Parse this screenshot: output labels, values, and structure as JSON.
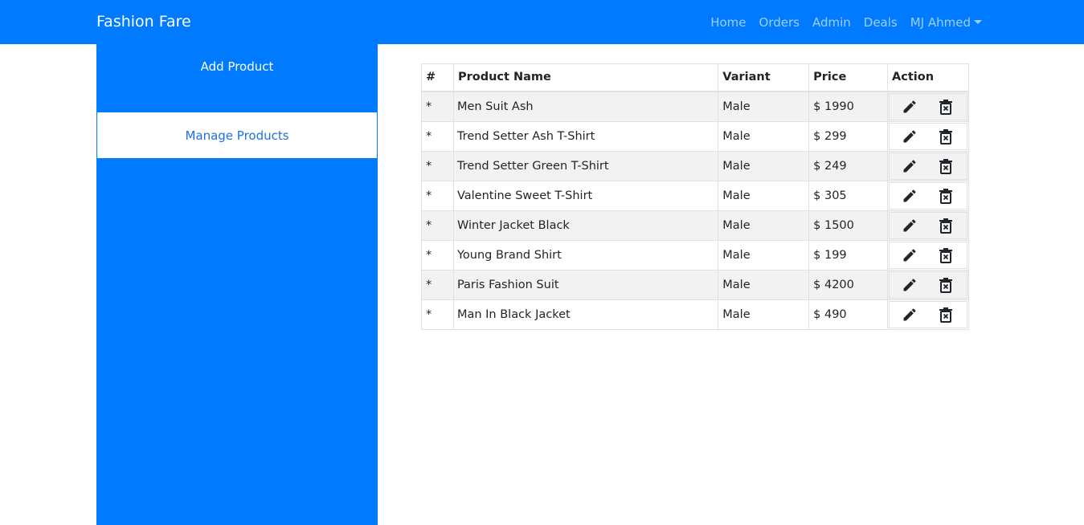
{
  "navbar": {
    "brand": "Fashion Fare",
    "links": [
      "Home",
      "Orders",
      "Admin",
      "Deals"
    ],
    "user": "MJ Ahmed"
  },
  "sidebar": {
    "add_product": "Add Product",
    "manage_products": "Manage Products"
  },
  "table": {
    "headers": [
      "#",
      "Product Name",
      "Variant",
      "Price",
      "Action"
    ],
    "rows": [
      {
        "num": "*",
        "name": "Men Suit Ash",
        "variant": "Male",
        "price": "$ 1990"
      },
      {
        "num": "*",
        "name": "Trend Setter Ash T-Shirt",
        "variant": "Male",
        "price": "$ 299"
      },
      {
        "num": "*",
        "name": "Trend Setter Green T-Shirt",
        "variant": "Male",
        "price": "$ 249"
      },
      {
        "num": "*",
        "name": "Valentine Sweet T-Shirt",
        "variant": "Male",
        "price": "$ 305"
      },
      {
        "num": "*",
        "name": "Winter Jacket Black",
        "variant": "Male",
        "price": "$ 1500"
      },
      {
        "num": "*",
        "name": "Young Brand Shirt",
        "variant": "Male",
        "price": "$ 199"
      },
      {
        "num": "*",
        "name": "Paris Fashion Suit",
        "variant": "Male",
        "price": "$ 4200"
      },
      {
        "num": "*",
        "name": "Man In Black Jacket",
        "variant": "Male",
        "price": "$ 490"
      }
    ]
  },
  "icons": {
    "edit": "pencil-icon",
    "delete": "trash-icon"
  },
  "colors": {
    "primary": "#007bff",
    "stripe": "#f2f2f2",
    "active_link": "#1e6fe6"
  }
}
